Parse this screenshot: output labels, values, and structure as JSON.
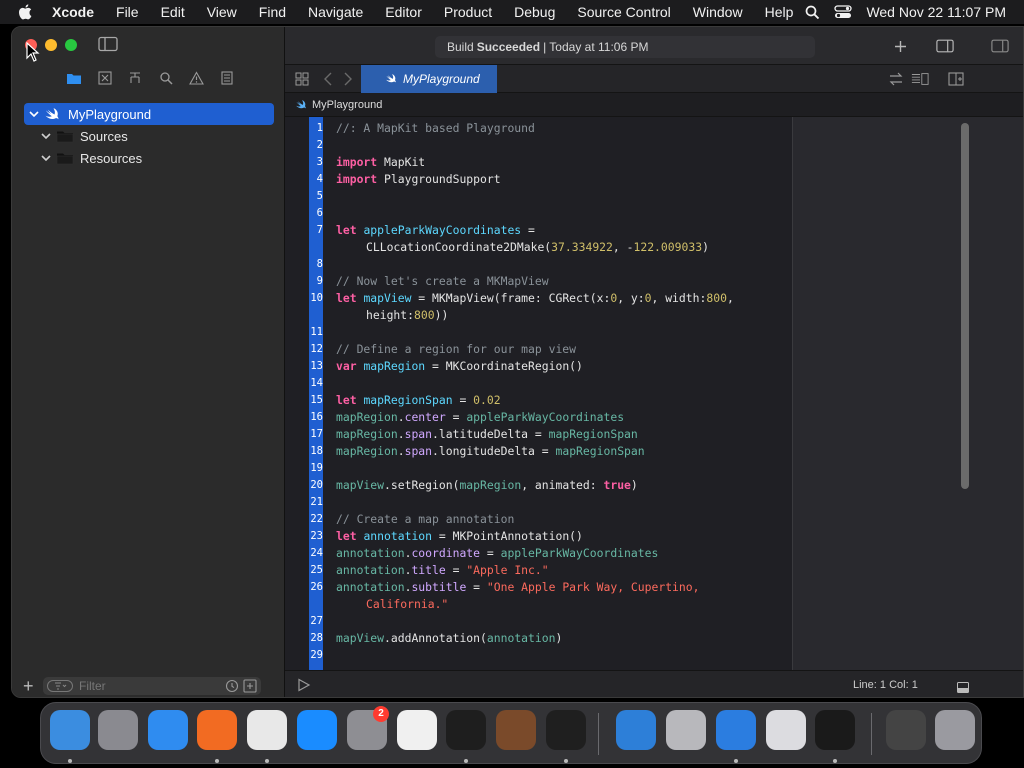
{
  "menubar": {
    "app_name": "Xcode",
    "items": [
      "File",
      "Edit",
      "View",
      "Find",
      "Navigate",
      "Editor",
      "Product",
      "Debug",
      "Source Control",
      "Window",
      "Help"
    ],
    "clock": "Wed Nov 22  11:07 PM"
  },
  "window": {
    "build_status": {
      "prefix": "Build",
      "state": "Succeeded",
      "suffix": "| Today at 11:06 PM"
    },
    "tab_label": "MyPlayground",
    "jumpbar_label": "MyPlayground"
  },
  "navigator": {
    "items": [
      {
        "label": "MyPlayground",
        "selected": true
      },
      {
        "label": "Sources",
        "selected": false
      },
      {
        "label": "Resources",
        "selected": false
      }
    ],
    "filter_placeholder": "Filter"
  },
  "editor": {
    "lines": [
      {
        "n": "1",
        "tokens": [
          {
            "c": "cm",
            "t": "//: A MapKit based Playground"
          }
        ]
      },
      {
        "n": "2",
        "tokens": []
      },
      {
        "n": "3",
        "tokens": [
          {
            "c": "kw",
            "t": "import"
          },
          {
            "c": "pl",
            "t": " MapKit"
          }
        ]
      },
      {
        "n": "4",
        "tokens": [
          {
            "c": "kw",
            "t": "import"
          },
          {
            "c": "pl",
            "t": " PlaygroundSupport"
          }
        ]
      },
      {
        "n": "5",
        "tokens": []
      },
      {
        "n": "6",
        "tokens": []
      },
      {
        "n": "7",
        "tokens": [
          {
            "c": "kw",
            "t": "let"
          },
          {
            "c": "pl",
            "t": " "
          },
          {
            "c": "pv",
            "t": "appleParkWayCoordinates"
          },
          {
            "c": "pl",
            "t": " ="
          }
        ]
      },
      {
        "n": "",
        "cont": true,
        "tokens": [
          {
            "c": "pl",
            "t": "CLLocationCoordinate2DMake("
          },
          {
            "c": "nm",
            "t": "37.334922"
          },
          {
            "c": "pl",
            "t": ", -"
          },
          {
            "c": "nm",
            "t": "122.009033"
          },
          {
            "c": "pl",
            "t": ")"
          }
        ]
      },
      {
        "n": "8",
        "tokens": []
      },
      {
        "n": "9",
        "tokens": [
          {
            "c": "cm",
            "t": "// Now let's create a MKMapView"
          }
        ]
      },
      {
        "n": "10",
        "tokens": [
          {
            "c": "kw",
            "t": "let"
          },
          {
            "c": "pl",
            "t": " "
          },
          {
            "c": "pv",
            "t": "mapView"
          },
          {
            "c": "pl",
            "t": " = MKMapView(frame: CGRect(x:"
          },
          {
            "c": "nm",
            "t": "0"
          },
          {
            "c": "pl",
            "t": ", y:"
          },
          {
            "c": "nm",
            "t": "0"
          },
          {
            "c": "pl",
            "t": ", width:"
          },
          {
            "c": "nm",
            "t": "800"
          },
          {
            "c": "pl",
            "t": ","
          }
        ]
      },
      {
        "n": "",
        "cont": true,
        "tokens": [
          {
            "c": "pl",
            "t": "height:"
          },
          {
            "c": "nm",
            "t": "800"
          },
          {
            "c": "pl",
            "t": "))"
          }
        ]
      },
      {
        "n": "11",
        "tokens": []
      },
      {
        "n": "12",
        "tokens": [
          {
            "c": "cm",
            "t": "// Define a region for our map view"
          }
        ]
      },
      {
        "n": "13",
        "tokens": [
          {
            "c": "kw",
            "t": "var"
          },
          {
            "c": "pl",
            "t": " "
          },
          {
            "c": "pv",
            "t": "mapRegion"
          },
          {
            "c": "pl",
            "t": " = MKCoordinateRegion()"
          }
        ]
      },
      {
        "n": "14",
        "tokens": []
      },
      {
        "n": "15",
        "tokens": [
          {
            "c": "kw",
            "t": "let"
          },
          {
            "c": "pl",
            "t": " "
          },
          {
            "c": "pv",
            "t": "mapRegionSpan"
          },
          {
            "c": "pl",
            "t": " = "
          },
          {
            "c": "nm",
            "t": "0.02"
          }
        ]
      },
      {
        "n": "16",
        "tokens": [
          {
            "c": "fn",
            "t": "mapRegion"
          },
          {
            "c": "pl",
            "t": "."
          },
          {
            "c": "ty",
            "t": "center"
          },
          {
            "c": "pl",
            "t": " = "
          },
          {
            "c": "fn",
            "t": "appleParkWayCoordinates"
          }
        ]
      },
      {
        "n": "17",
        "tokens": [
          {
            "c": "fn",
            "t": "mapRegion"
          },
          {
            "c": "pl",
            "t": "."
          },
          {
            "c": "ty",
            "t": "span"
          },
          {
            "c": "pl",
            "t": ".latitudeDelta = "
          },
          {
            "c": "fn",
            "t": "mapRegionSpan"
          }
        ]
      },
      {
        "n": "18",
        "tokens": [
          {
            "c": "fn",
            "t": "mapRegion"
          },
          {
            "c": "pl",
            "t": "."
          },
          {
            "c": "ty",
            "t": "span"
          },
          {
            "c": "pl",
            "t": ".longitudeDelta = "
          },
          {
            "c": "fn",
            "t": "mapRegionSpan"
          }
        ]
      },
      {
        "n": "19",
        "tokens": []
      },
      {
        "n": "20",
        "tokens": [
          {
            "c": "fn",
            "t": "mapView"
          },
          {
            "c": "pl",
            "t": ".setRegion("
          },
          {
            "c": "fn",
            "t": "mapRegion"
          },
          {
            "c": "pl",
            "t": ", animated: "
          },
          {
            "c": "kw",
            "t": "true"
          },
          {
            "c": "pl",
            "t": ")"
          }
        ]
      },
      {
        "n": "21",
        "tokens": []
      },
      {
        "n": "22",
        "tokens": [
          {
            "c": "cm",
            "t": "// Create a map annotation"
          }
        ]
      },
      {
        "n": "23",
        "tokens": [
          {
            "c": "kw",
            "t": "let"
          },
          {
            "c": "pl",
            "t": " "
          },
          {
            "c": "pv",
            "t": "annotation"
          },
          {
            "c": "pl",
            "t": " = MKPointAnnotation()"
          }
        ]
      },
      {
        "n": "24",
        "tokens": [
          {
            "c": "fn",
            "t": "annotation"
          },
          {
            "c": "pl",
            "t": "."
          },
          {
            "c": "ty",
            "t": "coordinate"
          },
          {
            "c": "pl",
            "t": " = "
          },
          {
            "c": "fn",
            "t": "appleParkWayCoordinates"
          }
        ]
      },
      {
        "n": "25",
        "tokens": [
          {
            "c": "fn",
            "t": "annotation"
          },
          {
            "c": "pl",
            "t": "."
          },
          {
            "c": "ty",
            "t": "title"
          },
          {
            "c": "pl",
            "t": " = "
          },
          {
            "c": "st",
            "t": "\"Apple Inc.\""
          }
        ]
      },
      {
        "n": "26",
        "tokens": [
          {
            "c": "fn",
            "t": "annotation"
          },
          {
            "c": "pl",
            "t": "."
          },
          {
            "c": "ty",
            "t": "subtitle"
          },
          {
            "c": "pl",
            "t": " = "
          },
          {
            "c": "st",
            "t": "\"One Apple Park Way, Cupertino,"
          }
        ]
      },
      {
        "n": "",
        "cont": true,
        "tokens": [
          {
            "c": "st",
            "t": "California.\""
          }
        ]
      },
      {
        "n": "27",
        "tokens": []
      },
      {
        "n": "28",
        "tokens": [
          {
            "c": "fn",
            "t": "mapView"
          },
          {
            "c": "pl",
            "t": ".addAnnotation("
          },
          {
            "c": "fn",
            "t": "annotation"
          },
          {
            "c": "pl",
            "t": ")"
          }
        ]
      },
      {
        "n": "29",
        "tokens": []
      }
    ],
    "cursor_position": "Line: 1  Col: 1"
  },
  "dock": {
    "settings_badge": "2",
    "apps": [
      {
        "name": "finder-icon",
        "color": "#3b8de0"
      },
      {
        "name": "launchpad-icon",
        "color": "#8a8a90"
      },
      {
        "name": "safari-icon",
        "color": "#2f8cf0"
      },
      {
        "name": "firefox-icon",
        "color": "#f26b22"
      },
      {
        "name": "chrome-icon",
        "color": "#e8e8e8"
      },
      {
        "name": "app-store-icon",
        "color": "#1a8cff"
      },
      {
        "name": "system-settings-icon",
        "color": "#8e8e93"
      },
      {
        "name": "textedit-icon",
        "color": "#f0f0f0"
      },
      {
        "name": "terminal-icon",
        "color": "#1e1e1e"
      },
      {
        "name": "instruments-icon",
        "color": "#7a4a2a"
      },
      {
        "name": "vscode-icon",
        "color": "#1f1f1f"
      },
      {
        "name": "weather-icon",
        "color": "#2d7fd8"
      },
      {
        "name": "installer-icon",
        "color": "#b8b8bc"
      },
      {
        "name": "xcode-icon",
        "color": "#2b7de0"
      },
      {
        "name": "blank-app-icon",
        "color": "#dcdce0"
      },
      {
        "name": "activity-monitor-icon",
        "color": "#1a1a1a"
      },
      {
        "name": "screenshot-folder-icon",
        "color": "#444"
      },
      {
        "name": "trash-icon",
        "color": "#9a9aa0"
      }
    ]
  }
}
